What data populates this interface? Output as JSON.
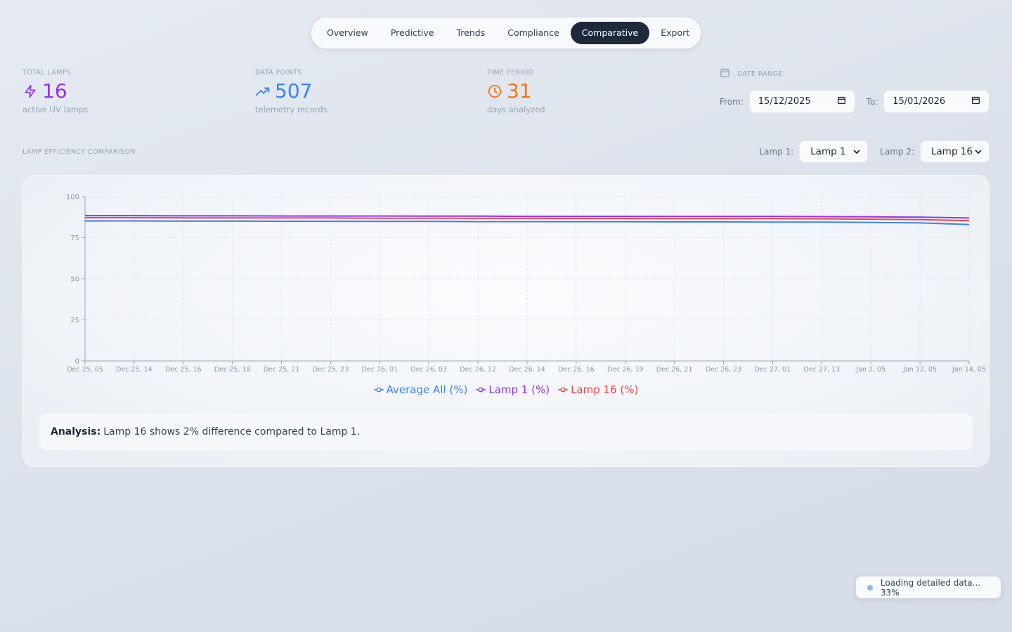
{
  "nav": {
    "tabs": [
      {
        "label": "Overview"
      },
      {
        "label": "Predictive"
      },
      {
        "label": "Trends"
      },
      {
        "label": "Compliance"
      },
      {
        "label": "Comparative"
      },
      {
        "label": "Export"
      }
    ],
    "active": "Comparative"
  },
  "stats": [
    {
      "label": "TOTAL LAMPS",
      "value": "16",
      "sub": "active UV lamps",
      "icon": "lightning-icon",
      "color": "#9333ea"
    },
    {
      "label": "DATA POINTS",
      "value": "507",
      "sub": "telemetry records",
      "icon": "trending-up-icon",
      "color": "#3b82f6"
    },
    {
      "label": "TIME PERIOD",
      "value": "31",
      "sub": "days analyzed",
      "icon": "clock-icon",
      "color": "#f97316"
    }
  ],
  "date_range": {
    "title": "DATE RANGE",
    "from_label": "From:",
    "from_value": "15/12/2025",
    "to_label": "To:",
    "to_value": "15/01/2026"
  },
  "comparison": {
    "title": "LAMP EFFICIENCY COMPARISON",
    "lamp1_label": "Lamp 1:",
    "lamp1_value": "Lamp 1",
    "lamp2_label": "Lamp 2:",
    "lamp2_value": "Lamp 16"
  },
  "analysis": {
    "prefix": "Analysis:",
    "text": "Lamp 16 shows 2% difference compared to Lamp 1."
  },
  "toast": {
    "text": "Loading detailed data... 33%"
  },
  "chart_data": {
    "type": "line",
    "x": [
      "Dec 25, 05",
      "Dec 25, 14",
      "Dec 25, 16",
      "Dec 25, 18",
      "Dec 25, 21",
      "Dec 25, 23",
      "Dec 26, 01",
      "Dec 26, 03",
      "Dec 26, 12",
      "Dec 26, 14",
      "Dec 26, 16",
      "Dec 26, 19",
      "Dec 26, 21",
      "Dec 26, 23",
      "Dec 27, 01",
      "Dec 27, 13",
      "Jan 2, 05",
      "Jan 12, 05",
      "Jan 14, 05"
    ],
    "ylim": [
      0,
      100
    ],
    "yticks": [
      0,
      25,
      50,
      75,
      100
    ],
    "grid": true,
    "legend": "bottom-center",
    "series": [
      {
        "name": "Average All (%)",
        "color": "#3b82f6",
        "values": [
          85.2,
          85.2,
          85.1,
          85.1,
          85.0,
          85.0,
          84.9,
          84.9,
          84.8,
          84.8,
          84.7,
          84.7,
          84.6,
          84.6,
          84.5,
          84.5,
          84.3,
          84.0,
          83.0
        ]
      },
      {
        "name": "Lamp 1 (%)",
        "color": "#9333ea",
        "values": [
          88.4,
          88.4,
          88.3,
          88.3,
          88.2,
          88.2,
          88.2,
          88.1,
          88.1,
          88.0,
          88.0,
          88.0,
          87.9,
          87.9,
          87.9,
          87.8,
          87.7,
          87.5,
          87.0
        ]
      },
      {
        "name": "Lamp 16 (%)",
        "color": "#ef4444",
        "values": [
          87.2,
          87.2,
          87.1,
          87.1,
          87.0,
          87.0,
          86.9,
          86.9,
          86.8,
          86.8,
          86.7,
          86.7,
          86.6,
          86.6,
          86.6,
          86.5,
          86.3,
          86.0,
          85.4
        ]
      }
    ]
  }
}
